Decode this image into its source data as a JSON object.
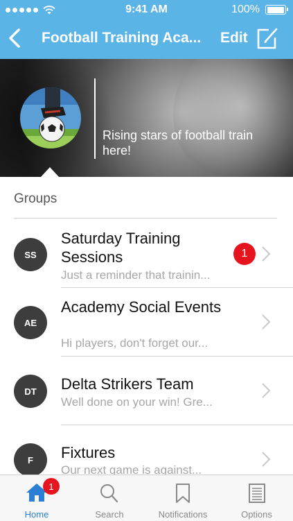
{
  "status_bar": {
    "time": "9:41 AM",
    "battery": "100%",
    "battery_level": 1.0
  },
  "nav": {
    "back_icon": "chevron-left-icon",
    "title": "Football Training Aca...",
    "edit_label": "Edit",
    "compose_icon": "compose-icon"
  },
  "banner": {
    "tagline": "Rising stars of football train here!",
    "avatar_icon": "football-avatar"
  },
  "groups": {
    "heading": "Groups",
    "items": [
      {
        "initials": "SS",
        "name": "Saturday Training Sessions",
        "preview": "Just a reminder that trainin...",
        "unread": "1"
      },
      {
        "initials": "AE",
        "name": "Academy Social Events",
        "preview": "Hi players, don't forget our...",
        "unread": ""
      },
      {
        "initials": "DT",
        "name": "Delta Strikers Team",
        "preview": "Well done on your win! Gre...",
        "unread": ""
      },
      {
        "initials": "F",
        "name": "Fixtures",
        "preview": "Our next game is against...",
        "unread": ""
      }
    ]
  },
  "tabbar": {
    "tabs": [
      {
        "label": "Home",
        "icon": "home-icon",
        "badge": "1",
        "active": true
      },
      {
        "label": "Search",
        "icon": "search-icon"
      },
      {
        "label": "Notifications",
        "icon": "bookmark-icon"
      },
      {
        "label": "Options",
        "icon": "list-icon"
      }
    ]
  },
  "colors": {
    "accent": "#5ab4e6",
    "badge": "#e5141e",
    "tab_active": "#2a7fd4"
  }
}
